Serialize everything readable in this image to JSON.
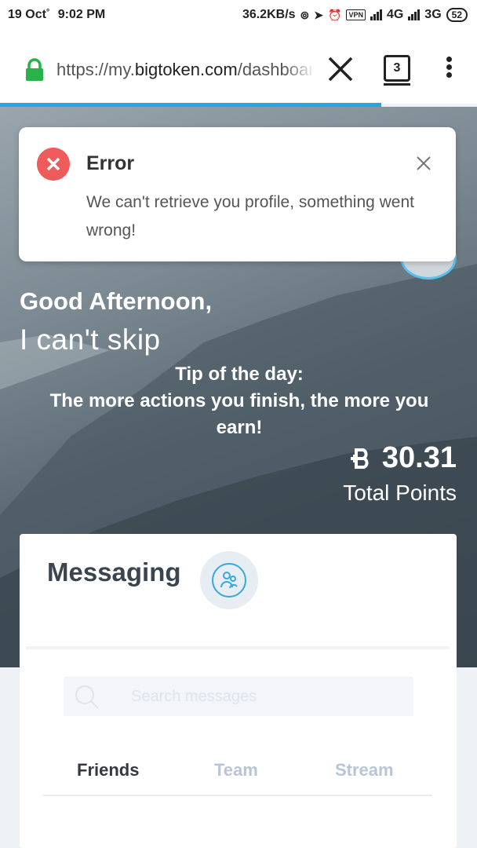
{
  "status_bar": {
    "date": "19 Oct",
    "time": "9:02 PM",
    "speed": "36.2KB/s",
    "vpn": "VPN",
    "net1": "4G",
    "net2": "3G",
    "battery": "52"
  },
  "browser": {
    "url_prefix": "https://my.",
    "url_domain": "bigtoken.com",
    "url_rest": "/dashboard",
    "tab_count": "3",
    "progress_fraction": 0.8
  },
  "toast": {
    "title": "Error",
    "message": "We can't retrieve you profile, something went wrong!"
  },
  "hero": {
    "greeting": "Good Afternoon,",
    "username": "I can't skip",
    "tip_line1": "Tip of the day:",
    "tip_line2": "The more actions you finish, the more you earn!",
    "points_value": "30.31",
    "points_label": "Total Points"
  },
  "messaging": {
    "title": "Messaging",
    "search_placeholder": "Search messages",
    "tabs": [
      "Friends",
      "Team",
      "Stream"
    ]
  },
  "colors": {
    "accent": "#2aa3e6",
    "error": "#ef5a5a"
  }
}
